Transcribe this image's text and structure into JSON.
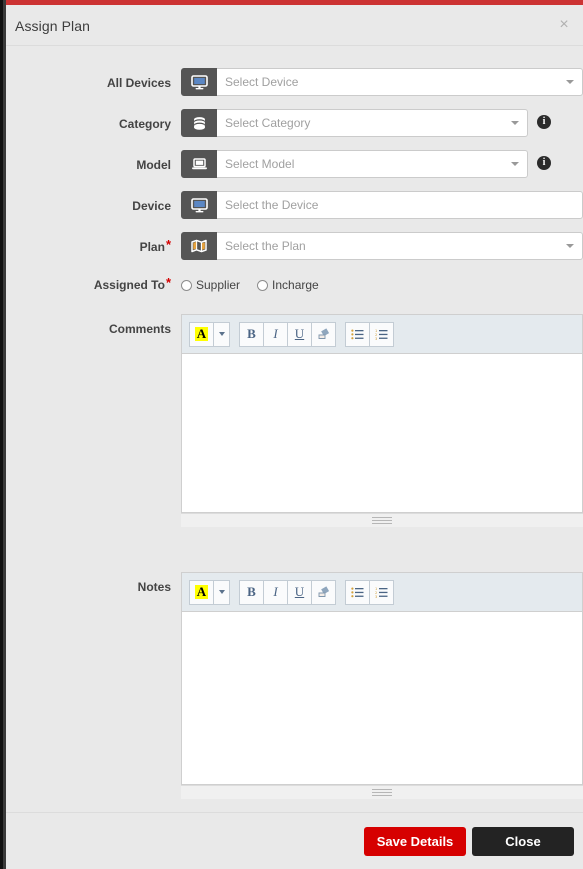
{
  "theme": {
    "accent_red": "#cc3333",
    "save_button_red": "#d60000",
    "close_button_dark": "#232323",
    "addon_gray": "#555555",
    "modal_bg": "#e9e9e9",
    "required_star": "#d40000",
    "highlight_yellow": "#ffff00"
  },
  "modal": {
    "title": "Assign Plan",
    "close_icon": "close-icon",
    "close_glyph": "×"
  },
  "form": {
    "fields": [
      {
        "label": "All Devices",
        "required": false,
        "icon": "monitor-icon",
        "placeholder": "Select Device",
        "value": "",
        "has_caret": true,
        "has_info": false
      },
      {
        "label": "Category",
        "required": false,
        "icon": "database-icon",
        "placeholder": "Select Category",
        "value": "",
        "has_caret": true,
        "has_info": true
      },
      {
        "label": "Model",
        "required": false,
        "icon": "laptop-icon",
        "placeholder": "Select Model",
        "value": "",
        "has_caret": true,
        "has_info": true
      },
      {
        "label": "Device",
        "required": false,
        "icon": "monitor-icon",
        "placeholder": "Select the Device",
        "value": "",
        "has_caret": false,
        "has_info": false
      },
      {
        "label": "Plan",
        "required": true,
        "icon": "map-icon",
        "placeholder": "Select the Plan",
        "value": "",
        "has_caret": true,
        "has_info": false
      }
    ],
    "assigned_to": {
      "label": "Assigned To",
      "required": true,
      "options": [
        {
          "label": "Supplier",
          "selected": false
        },
        {
          "label": "Incharge",
          "selected": false
        }
      ]
    },
    "comments": {
      "label": "Comments",
      "value": "",
      "toolbar": [
        {
          "name": "font-color-icon",
          "glyph": "A"
        },
        {
          "name": "font-color-dropdown-icon",
          "glyph": ""
        },
        {
          "name": "bold-icon",
          "glyph": "B"
        },
        {
          "name": "italic-icon",
          "glyph": "I"
        },
        {
          "name": "underline-icon",
          "glyph": "U"
        },
        {
          "name": "eraser-icon",
          "glyph": ""
        },
        {
          "name": "unordered-list-icon",
          "glyph": ""
        },
        {
          "name": "ordered-list-icon",
          "glyph": ""
        }
      ]
    },
    "notes": {
      "label": "Notes",
      "value": "",
      "toolbar": [
        {
          "name": "font-color-icon",
          "glyph": "A"
        },
        {
          "name": "font-color-dropdown-icon",
          "glyph": ""
        },
        {
          "name": "bold-icon",
          "glyph": "B"
        },
        {
          "name": "italic-icon",
          "glyph": "I"
        },
        {
          "name": "underline-icon",
          "glyph": "U"
        },
        {
          "name": "eraser-icon",
          "glyph": ""
        },
        {
          "name": "unordered-list-icon",
          "glyph": ""
        },
        {
          "name": "ordered-list-icon",
          "glyph": ""
        }
      ]
    },
    "info_glyph": "i"
  },
  "footer": {
    "save_label": "Save Details",
    "close_label": "Close"
  }
}
